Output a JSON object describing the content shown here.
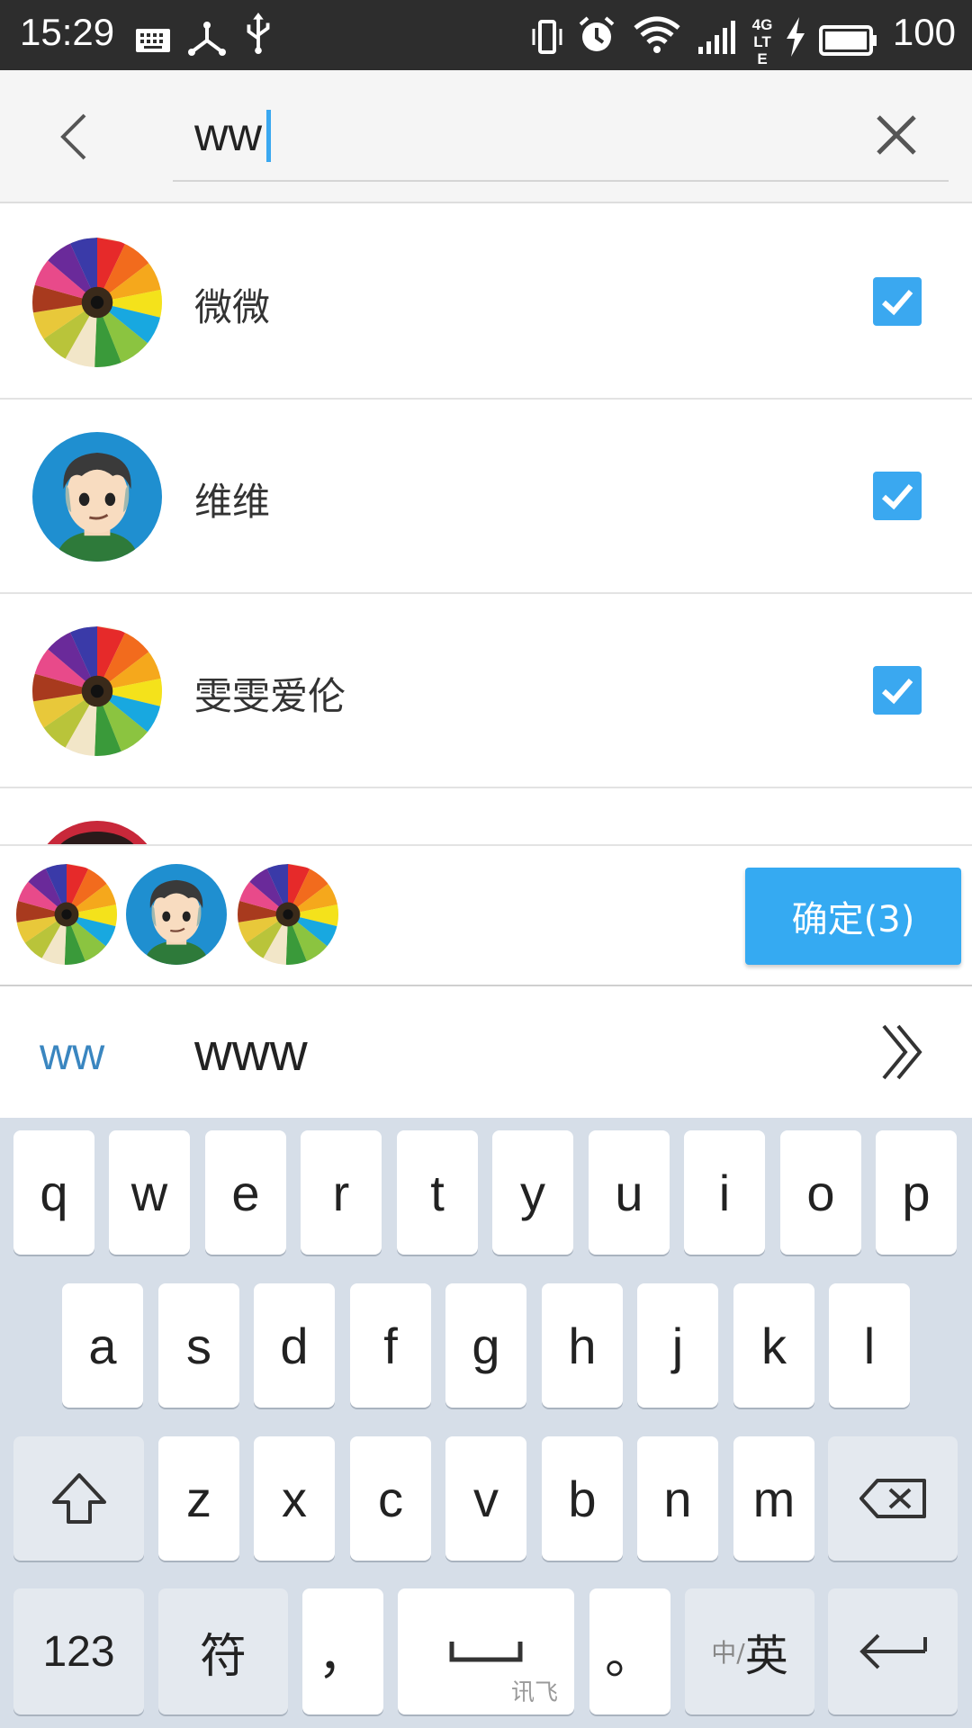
{
  "status_bar": {
    "time": "15:29",
    "battery": "100",
    "network": "4G LTE",
    "icons": [
      "keyboard-icon",
      "share-icon",
      "usb-icon",
      "vibrate-icon",
      "alarm-icon",
      "wifi-icon",
      "signal-icon",
      "charging-icon",
      "battery-icon"
    ]
  },
  "search": {
    "value": "ww",
    "back_icon": "back-arrow-icon",
    "clear_icon": "close-icon"
  },
  "contacts": [
    {
      "name": "微微",
      "checked": true,
      "avatar": "pencils-avatar"
    },
    {
      "name": "维维",
      "checked": true,
      "avatar": "cartoon-boy-avatar"
    },
    {
      "name": "雯雯爱伦",
      "checked": true,
      "avatar": "pencils-avatar"
    }
  ],
  "selection": {
    "confirm_label": "确定(3)",
    "selected_count": 3
  },
  "candidates": {
    "typed": "ww",
    "suggestion": "www",
    "expand_icon": "double-chevron-right-icon"
  },
  "keyboard": {
    "row1": [
      "q",
      "w",
      "e",
      "r",
      "t",
      "y",
      "u",
      "i",
      "o",
      "p"
    ],
    "row2": [
      "a",
      "s",
      "d",
      "f",
      "g",
      "h",
      "j",
      "k",
      "l"
    ],
    "row3": [
      "z",
      "x",
      "c",
      "v",
      "b",
      "n",
      "m"
    ],
    "num_label": "123",
    "symbol_label": "符",
    "comma_label": "，",
    "space_brand": "讯飞",
    "period_label": "。",
    "lang_small": "中/",
    "lang_big": "英",
    "colors": {
      "keyboard_bg": "#d6dee8",
      "accent": "#35aaf2"
    }
  }
}
